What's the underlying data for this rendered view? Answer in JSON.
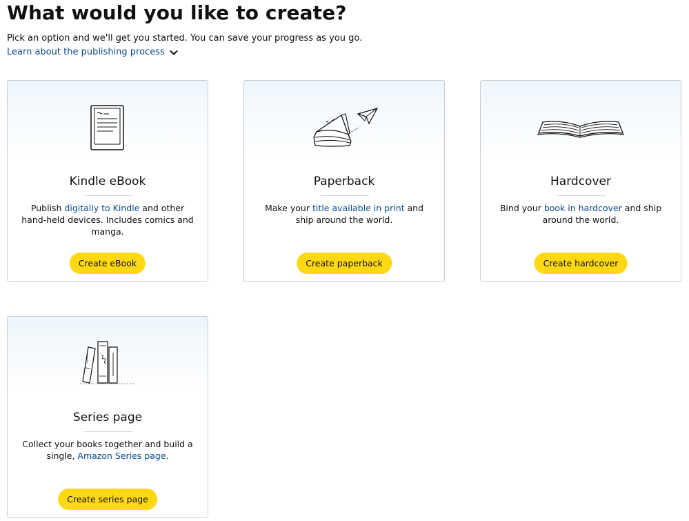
{
  "header": {
    "title": "What would you like to create?",
    "subtitle": "Pick an option and we'll get you started. You can save your progress as you go.",
    "learn_link": "Learn about the publishing process"
  },
  "cards": [
    {
      "title": "Kindle eBook",
      "desc_pre": "Publish ",
      "desc_link": "digitally to Kindle",
      "desc_post": " and other hand-held devices. Includes comics and manga.",
      "button": "Create eBook",
      "icon": "kindle-device-icon"
    },
    {
      "title": "Paperback",
      "desc_pre": "Make your ",
      "desc_link": "title available in print",
      "desc_post": " and ship around the world.",
      "button": "Create paperback",
      "icon": "paperback-book-icon"
    },
    {
      "title": "Hardcover",
      "desc_pre": "Bind your ",
      "desc_link": "book in hardcover",
      "desc_post": " and ship around the world.",
      "button": "Create hardcover",
      "icon": "open-book-icon"
    },
    {
      "title": "Series page",
      "desc_pre": "Collect your books together and build a single, ",
      "desc_link": "Amazon Series page",
      "desc_post": ".",
      "button": "Create series page",
      "icon": "book-series-icon"
    }
  ],
  "colors": {
    "button": "#ffd814",
    "link": "#0d4a8b",
    "border": "#c9ccd1"
  }
}
